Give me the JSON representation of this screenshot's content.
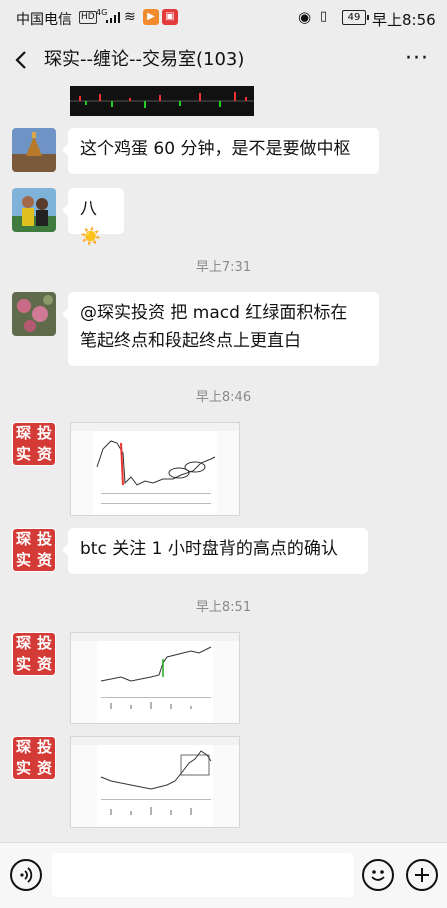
{
  "status_bar": {
    "carrier": "中国电信",
    "hd": "HD",
    "network": "4G",
    "battery": "49",
    "time": "早上8:56"
  },
  "header": {
    "title": "琛实--缠论--交易室(103)",
    "more": "···"
  },
  "messages": [
    {
      "type": "text",
      "text": "这个鸡蛋 60 分钟，是不是要做中枢"
    },
    {
      "type": "text",
      "text": "八☀️"
    },
    {
      "type": "timestamp",
      "text": "早上7:31"
    },
    {
      "type": "text",
      "line1": "@琛实投资  把 macd 红绿面积标在",
      "line2": "笔起终点和段起终点上更直白"
    },
    {
      "type": "timestamp",
      "text": "早上8:46"
    },
    {
      "type": "image",
      "desc": "chart-screenshot"
    },
    {
      "type": "text",
      "text": "btc 关注 1 小时盘背的高点的确认"
    },
    {
      "type": "timestamp",
      "text": "早上8:51"
    },
    {
      "type": "image",
      "desc": "chart-screenshot"
    },
    {
      "type": "image",
      "desc": "chart-screenshot"
    }
  ],
  "seal": {
    "c1": "投",
    "c2": "琛",
    "c3": "资",
    "c4": "实"
  },
  "icons": {
    "back": "chevron-left-icon",
    "voice": "voice-icon",
    "emoji": "emoji-icon",
    "plus": "plus-icon"
  },
  "colors": {
    "background": "#ededed",
    "seal_red": "#d43b36",
    "bubble": "#ffffff"
  }
}
